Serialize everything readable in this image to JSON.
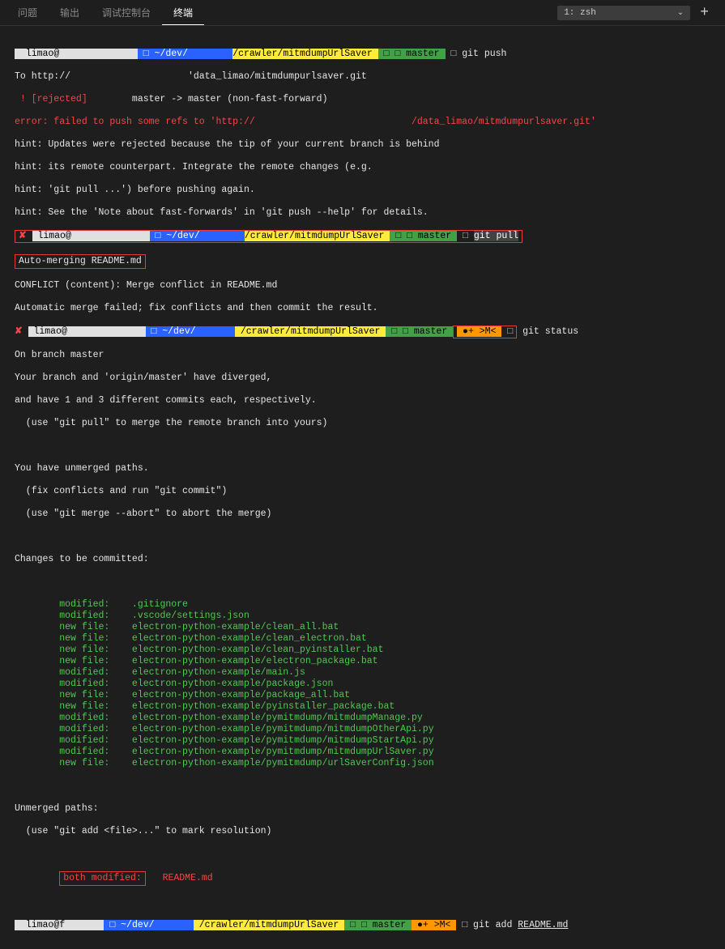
{
  "tabs": {
    "problems": "问题",
    "output": "输出",
    "debug": "调试控制台",
    "terminal": "终端"
  },
  "shell": {
    "label": "1: zsh",
    "plus": "+"
  },
  "prompt": {
    "user": "limao@",
    "path_prefix": " ~/dev/",
    "crawler": "/crawler/mitmdumpUrlSaver",
    "branch": "master",
    "merge_indicator": ">M<",
    "diverge_marker": "●+"
  },
  "cmd": {
    "git_push": "git push",
    "git_pull": "git pull",
    "git_status": "git status",
    "git_add": "git add README.md",
    "git_add_file": "README.md"
  },
  "output": {
    "to_url": "To http://",
    "repo_path": "'data_limao/mitmdumpurlsaver.git",
    "rejected": " ! [rejected]",
    "rejected_msg": "        master -> master (non-fast-forward)",
    "error_prefix": "error: failed to push some refs to 'http://",
    "error_suffix": "/data_limao/mitmdumpurlsaver.git'",
    "hint1": "hint: Updates were rejected because the tip of your current branch is behind",
    "hint2": "hint: its remote counterpart. Integrate the remote changes (e.g.",
    "hint3": "hint: 'git pull ...') before pushing again.",
    "hint4": "hint: See the 'Note about fast-forwards' in 'git push --help' for details.",
    "auto_merge": "Auto-merging README.md",
    "conflict": "CONFLICT (content): Merge conflict in README.md",
    "auto_fail": "Automatic merge failed; fix conflicts and then commit the result.",
    "on_branch": "On branch master",
    "diverged": "Your branch and 'origin/master' have diverged,",
    "commits": "and have 1 and 3 different commits each, respectively.",
    "use_pull": "  (use \"git pull\" to merge the remote branch into yours)",
    "unmerged": "You have unmerged paths.",
    "fix_conf": "  (fix conflicts and run \"git commit\")",
    "abort": "  (use \"git merge --abort\" to abort the merge)",
    "changes": "Changes to be committed:",
    "files": [
      {
        "status": "modified:",
        "file": ".gitignore"
      },
      {
        "status": "modified:",
        "file": ".vscode/settings.json"
      },
      {
        "status": "new file:",
        "file": "electron-python-example/clean_all.bat"
      },
      {
        "status": "new file:",
        "file": "electron-python-example/clean_electron.bat"
      },
      {
        "status": "new file:",
        "file": "electron-python-example/clean_pyinstaller.bat"
      },
      {
        "status": "new file:",
        "file": "electron-python-example/electron_package.bat"
      },
      {
        "status": "modified:",
        "file": "electron-python-example/main.js"
      },
      {
        "status": "modified:",
        "file": "electron-python-example/package.json"
      },
      {
        "status": "new file:",
        "file": "electron-python-example/package_all.bat"
      },
      {
        "status": "new file:",
        "file": "electron-python-example/pyinstaller_package.bat"
      },
      {
        "status": "modified:",
        "file": "electron-python-example/pymitmdump/mitmdumpManage.py"
      },
      {
        "status": "modified:",
        "file": "electron-python-example/pymitmdump/mitmdumpOtherApi.py"
      },
      {
        "status": "modified:",
        "file": "electron-python-example/pymitmdump/mitmdumpStartApi.py"
      },
      {
        "status": "modified:",
        "file": "electron-python-example/pymitmdump/mitmdumpUrlSaver.py"
      },
      {
        "status": "new file:",
        "file": "electron-python-example/pymitmdump/urlSaverConfig.json"
      }
    ],
    "unmerged_paths": "Unmerged paths:",
    "mark_res": "  (use \"git add <file>...\" to mark resolution)",
    "both_mod": "both modified:",
    "both_file": "README.md",
    "final_user": "limao@f"
  },
  "icons": {
    "x": "✘",
    "square": "□",
    "chevron": "⌄"
  }
}
